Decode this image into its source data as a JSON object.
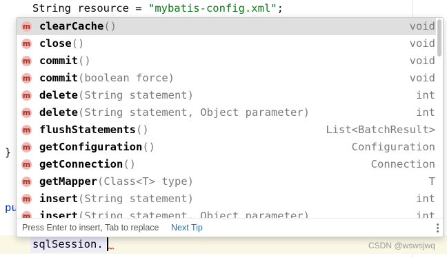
{
  "editor": {
    "line_resource_prefix": "String resource = ",
    "line_resource_string": "\"mybatis-config.xml\"",
    "line_resource_suffix": ";",
    "brace": "}",
    "pu_fragment": "pu",
    "sql_session_var": "sqlSession",
    "sql_session_dot": "."
  },
  "completion": {
    "items": [
      {
        "name": "clearCache",
        "params": "()",
        "return_type": "void",
        "selected": true
      },
      {
        "name": "close",
        "params": "()",
        "return_type": "void"
      },
      {
        "name": "commit",
        "params": "()",
        "return_type": "void"
      },
      {
        "name": "commit",
        "params": "(boolean force)",
        "return_type": "void"
      },
      {
        "name": "delete",
        "params": "(String statement)",
        "return_type": "int"
      },
      {
        "name": "delete",
        "params": "(String statement, Object parameter)",
        "return_type": "int"
      },
      {
        "name": "flushStatements",
        "params": "()",
        "return_type": "List<BatchResult>"
      },
      {
        "name": "getConfiguration",
        "params": "()",
        "return_type": "Configuration"
      },
      {
        "name": "getConnection",
        "params": "()",
        "return_type": "Connection"
      },
      {
        "name": "getMapper",
        "params": "(Class<T> type)",
        "return_type": "T"
      },
      {
        "name": "insert",
        "params": "(String statement)",
        "return_type": "int"
      },
      {
        "name": "insert",
        "params": "(String statement, Object parameter)",
        "return_type": "int"
      }
    ],
    "method_icon_letter": "m",
    "footer_hint": "Press Enter to insert, Tab to replace",
    "next_tip_label": "Next Tip"
  },
  "watermark": "CSDN @wswsjwq",
  "colors": {
    "selected_row": "#dfdfe0",
    "method_icon": "#f3b6b1",
    "string_literal": "#067d17",
    "link": "#2470b3"
  }
}
